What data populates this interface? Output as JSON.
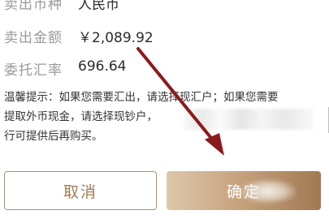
{
  "form": {
    "sell_currency_label": "卖出币种",
    "sell_currency_value": "人民币",
    "sell_amount_label": "卖出金额",
    "sell_amount_value": "￥2,089.92",
    "rate_label": "委托汇率",
    "rate_value": "696.64"
  },
  "notice": {
    "line1": "温馨提示：如果您需要汇出，请选择现汇户；如果您需要",
    "line2": "提取外币现金，请选择现钞户，",
    "line3": "行可提供后再购买。"
  },
  "buttons": {
    "cancel_label": "取消",
    "confirm_label": "确定"
  },
  "colors": {
    "accent_gold": "#b58e6a",
    "arrow_red": "#8b1b1b"
  }
}
